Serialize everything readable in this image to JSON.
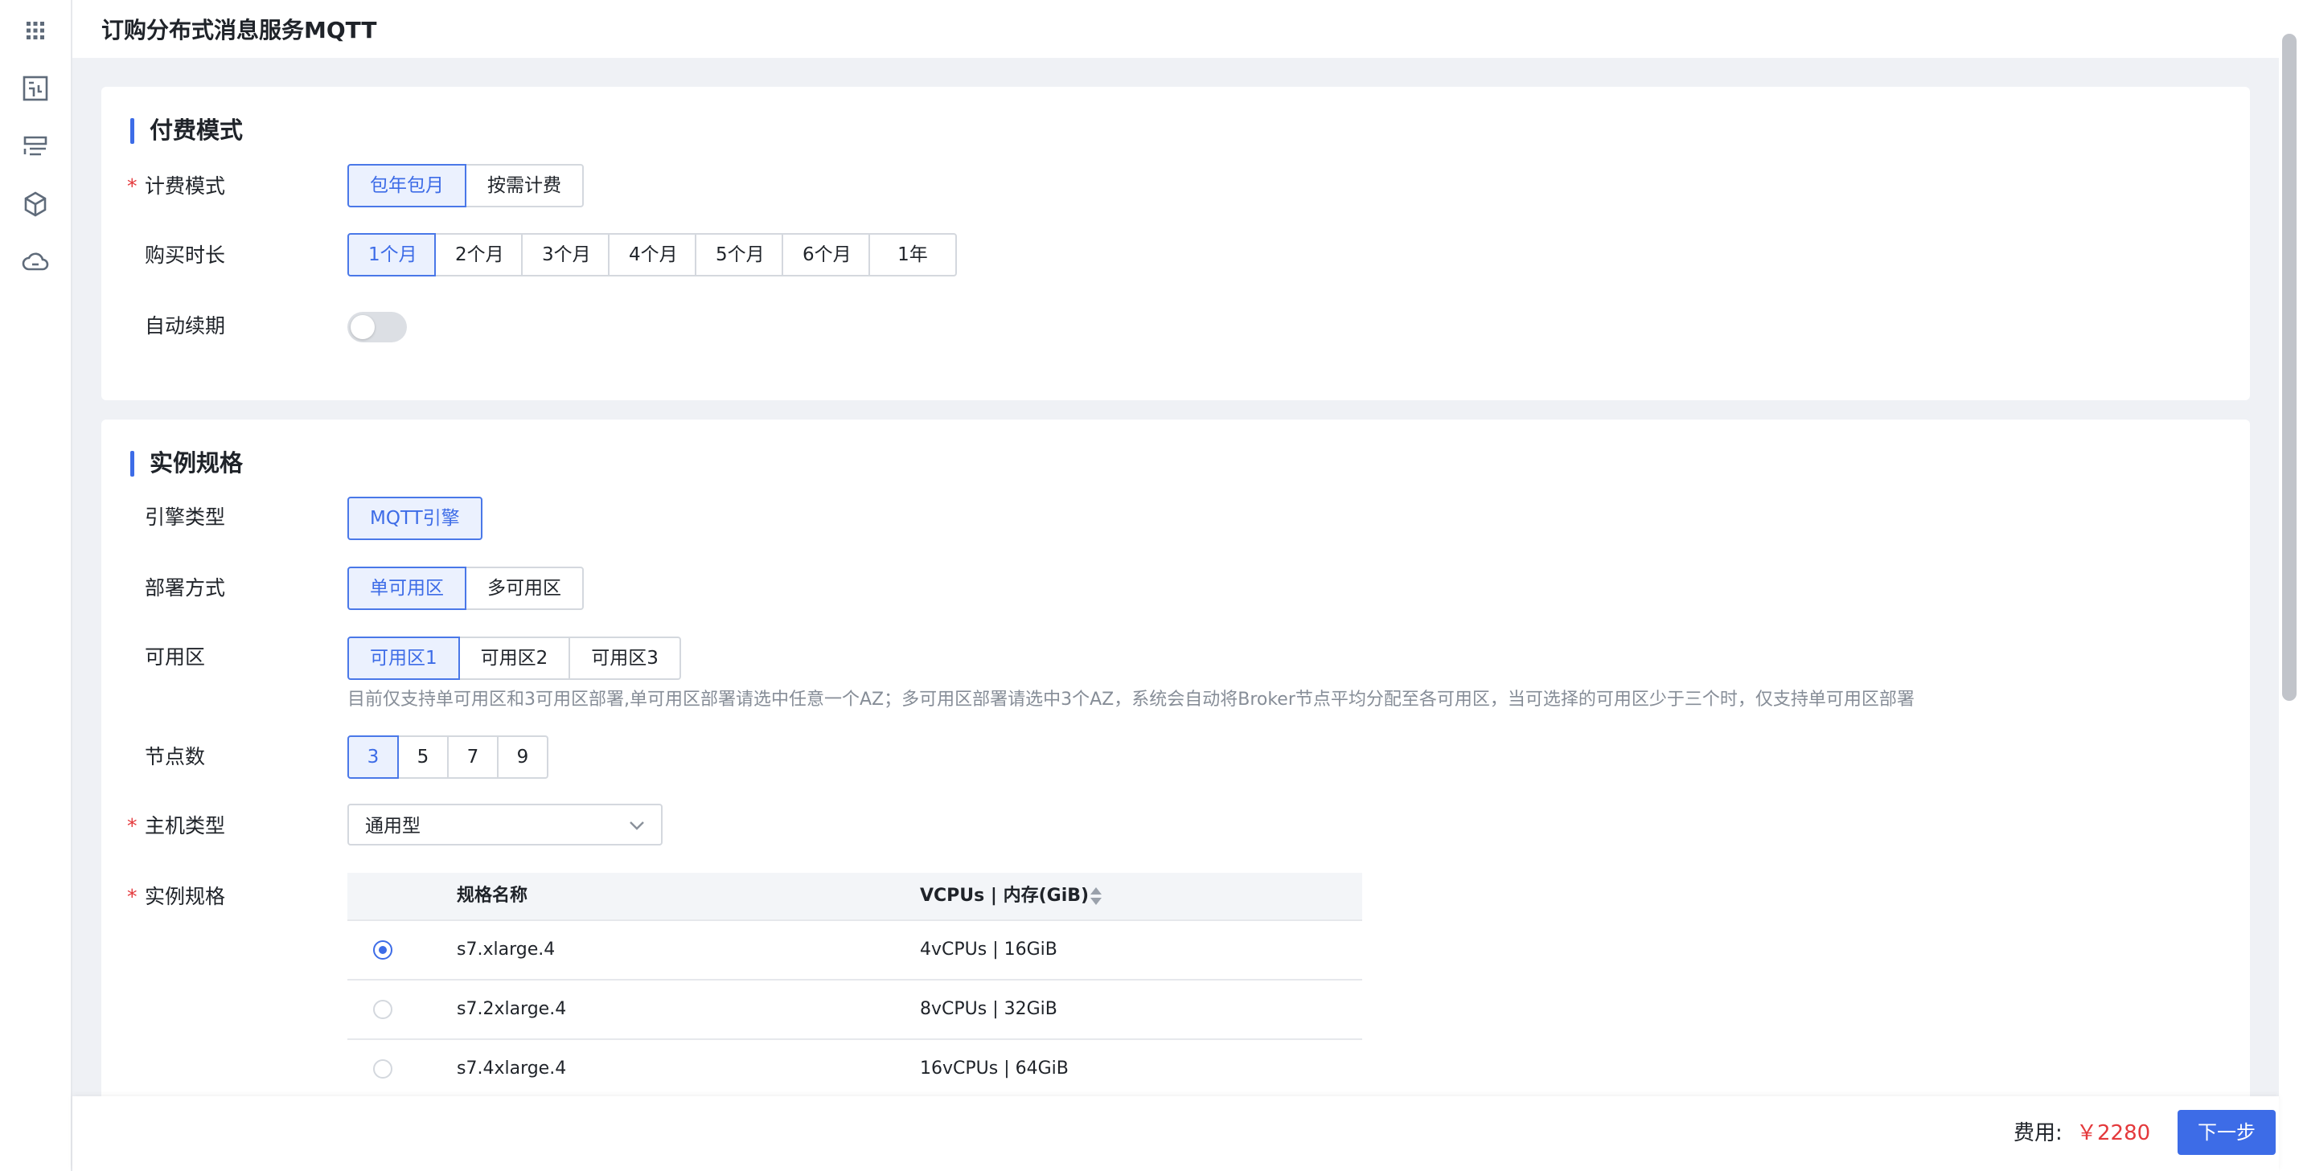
{
  "header": {
    "title": "订购分布式消息服务MQTT"
  },
  "rail": {
    "icons": [
      "apps-grid-icon",
      "dashboard-icon",
      "list-icon",
      "cube-icon",
      "cloud-icon"
    ]
  },
  "billing": {
    "section_title": "付费模式",
    "mode": {
      "label": "计费模式",
      "required": "*",
      "options": [
        "包年包月",
        "按需计费"
      ],
      "selected": "包年包月"
    },
    "duration": {
      "label": "购买时长",
      "options": [
        "1个月",
        "2个月",
        "3个月",
        "4个月",
        "5个月",
        "6个月",
        "1年"
      ],
      "selected": "1个月"
    },
    "auto_renew": {
      "label": "自动续期",
      "on": false
    }
  },
  "spec": {
    "section_title": "实例规格",
    "engine": {
      "label": "引擎类型",
      "options": [
        "MQTT引擎"
      ],
      "selected": "MQTT引擎"
    },
    "deploy": {
      "label": "部署方式",
      "options": [
        "单可用区",
        "多可用区"
      ],
      "selected": "单可用区"
    },
    "zone": {
      "label": "可用区",
      "options": [
        "可用区1",
        "可用区2",
        "可用区3"
      ],
      "selected": "可用区1",
      "hint": "目前仅支持单可用区和3可用区部署,单可用区部署请选中任意一个AZ；多可用区部署请选中3个AZ，系统会自动将Broker节点平均分配至各可用区，当可选择的可用区少于三个时，仅支持单可用区部署"
    },
    "nodes": {
      "label": "节点数",
      "options": [
        "3",
        "5",
        "7",
        "9"
      ],
      "selected": "3"
    },
    "host_type": {
      "label": "主机类型",
      "required": "*",
      "value": "通用型"
    },
    "instance": {
      "label": "实例规格",
      "required": "*",
      "columns": [
        "规格名称",
        "VCPUs | 内存(GiB)"
      ],
      "rows": [
        {
          "name": "s7.xlarge.4",
          "spec": "4vCPUs | 16GiB",
          "selected": true
        },
        {
          "name": "s7.2xlarge.4",
          "spec": "8vCPUs | 32GiB",
          "selected": false
        },
        {
          "name": "s7.4xlarge.4",
          "spec": "16vCPUs | 64GiB",
          "selected": false
        }
      ]
    }
  },
  "footer": {
    "fee_label": "费用:",
    "fee_value": "￥2280",
    "next_label": "下一步"
  },
  "colors": {
    "accent": "#3d6ce7",
    "price": "#e4393c"
  }
}
